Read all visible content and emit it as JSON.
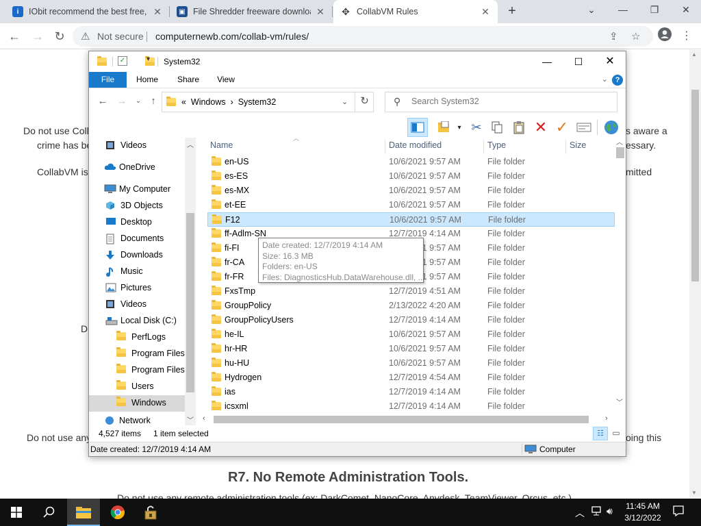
{
  "browser": {
    "tabs": [
      {
        "title": "IObit recommend the best free, f",
        "icon": "iobit-favicon",
        "color": "#1b6ac9",
        "active": false
      },
      {
        "title": "File Shredder freeware downloac",
        "icon": "shredder-favicon",
        "color": "#1d4f91",
        "active": false
      },
      {
        "title": "CollabVM Rules",
        "icon": "collabvm-favicon",
        "color": "#444444",
        "active": true
      }
    ],
    "new_tab": "+",
    "security_label": "Not secure",
    "url": "computernewb.com/collab-vm/rules/"
  },
  "webpage": {
    "lines": [
      {
        "text": "Do not use Coll"
      },
      {
        "text": "crime has be"
      },
      {
        "text": "s aware a"
      },
      {
        "text": "essary."
      },
      {
        "text": "CollabVM is"
      },
      {
        "text": "mitted"
      },
      {
        "text": "D"
      },
      {
        "text": "Do not use any"
      },
      {
        "text": "oing this"
      }
    ],
    "heading": "R7. No Remote Administration Tools.",
    "footer_line": "Do not use any remote administration tools (ex: DarkComet, NanoCore, Anydesk, TeamViewer, Orcus, etc.)"
  },
  "explorer": {
    "title": "System32",
    "ribbon_tabs": [
      "File",
      "Home",
      "Share",
      "View"
    ],
    "breadcrumb": {
      "prefix": "«",
      "parts": [
        "Windows",
        "System32"
      ],
      "sep": "›"
    },
    "search_placeholder": "Search System32",
    "nav": [
      {
        "label": "Videos",
        "icon": "videos-icon",
        "indent": 1
      },
      {
        "label": "OneDrive",
        "icon": "onedrive-icon",
        "indent": 0
      },
      {
        "label": "My Computer",
        "icon": "computer-icon",
        "indent": 0
      },
      {
        "label": "3D Objects",
        "icon": "3d-objects-icon",
        "indent": 1
      },
      {
        "label": "Desktop",
        "icon": "desktop-icon",
        "indent": 1
      },
      {
        "label": "Documents",
        "icon": "documents-icon",
        "indent": 1
      },
      {
        "label": "Downloads",
        "icon": "downloads-icon",
        "indent": 1
      },
      {
        "label": "Music",
        "icon": "music-icon",
        "indent": 1
      },
      {
        "label": "Pictures",
        "icon": "pictures-icon",
        "indent": 1
      },
      {
        "label": "Videos",
        "icon": "videos-icon",
        "indent": 1
      },
      {
        "label": "Local Disk (C:)",
        "icon": "drive-icon",
        "indent": 1
      },
      {
        "label": "PerfLogs",
        "icon": "folder-icon",
        "indent": 2
      },
      {
        "label": "Program Files",
        "icon": "folder-icon",
        "indent": 2
      },
      {
        "label": "Program Files (",
        "icon": "folder-icon",
        "indent": 2
      },
      {
        "label": "Users",
        "icon": "folder-icon",
        "indent": 2
      },
      {
        "label": "Windows",
        "icon": "folder-icon",
        "indent": 2,
        "selected": true
      },
      {
        "label": "Network",
        "icon": "network-icon",
        "indent": 0
      }
    ],
    "columns": [
      "Name",
      "Date modified",
      "Type",
      "Size"
    ],
    "rows": [
      {
        "name": "en-US",
        "date": "10/6/2021 9:57 AM",
        "type": "File folder"
      },
      {
        "name": "es-ES",
        "date": "10/6/2021 9:57 AM",
        "type": "File folder"
      },
      {
        "name": "es-MX",
        "date": "10/6/2021 9:57 AM",
        "type": "File folder"
      },
      {
        "name": "et-EE",
        "date": "10/6/2021 9:57 AM",
        "type": "File folder"
      },
      {
        "name": "F12",
        "date": "10/6/2021 9:57 AM",
        "type": "File folder",
        "selected": true
      },
      {
        "name": "ff-Adlm-SN",
        "date": "12/7/2019 4:14 AM",
        "type": "File folder"
      },
      {
        "name": "fi-FI",
        "date": "10/6/2021 9:57 AM",
        "type": "File folder"
      },
      {
        "name": "fr-CA",
        "date": "10/6/2021 9:57 AM",
        "type": "File folder"
      },
      {
        "name": "fr-FR",
        "date": "10/6/2021 9:57 AM",
        "type": "File folder"
      },
      {
        "name": "FxsTmp",
        "date": "12/7/2019 4:51 AM",
        "type": "File folder"
      },
      {
        "name": "GroupPolicy",
        "date": "2/13/2022 4:20 AM",
        "type": "File folder"
      },
      {
        "name": "GroupPolicyUsers",
        "date": "12/7/2019 4:14 AM",
        "type": "File folder"
      },
      {
        "name": "he-IL",
        "date": "10/6/2021 9:57 AM",
        "type": "File folder"
      },
      {
        "name": "hr-HR",
        "date": "10/6/2021 9:57 AM",
        "type": "File folder"
      },
      {
        "name": "hu-HU",
        "date": "10/6/2021 9:57 AM",
        "type": "File folder"
      },
      {
        "name": "Hydrogen",
        "date": "12/7/2019 4:54 AM",
        "type": "File folder"
      },
      {
        "name": "ias",
        "date": "12/7/2019 4:14 AM",
        "type": "File folder"
      },
      {
        "name": "icsxml",
        "date": "12/7/2019 4:14 AM",
        "type": "File folder"
      }
    ],
    "tooltip": [
      "Date created: 12/7/2019 4:14 AM",
      "Size: 16.3 MB",
      "Folders: en-US",
      "Files: DiagnosticsHub.DataWarehouse.dll, ..."
    ],
    "status": {
      "count": "4,527 items",
      "selection": "1 item selected",
      "details": "Date created: 12/7/2019 4:14 AM",
      "location": "Computer"
    }
  },
  "taskbar": {
    "time": "11:45 AM",
    "date": "3/12/2022"
  }
}
